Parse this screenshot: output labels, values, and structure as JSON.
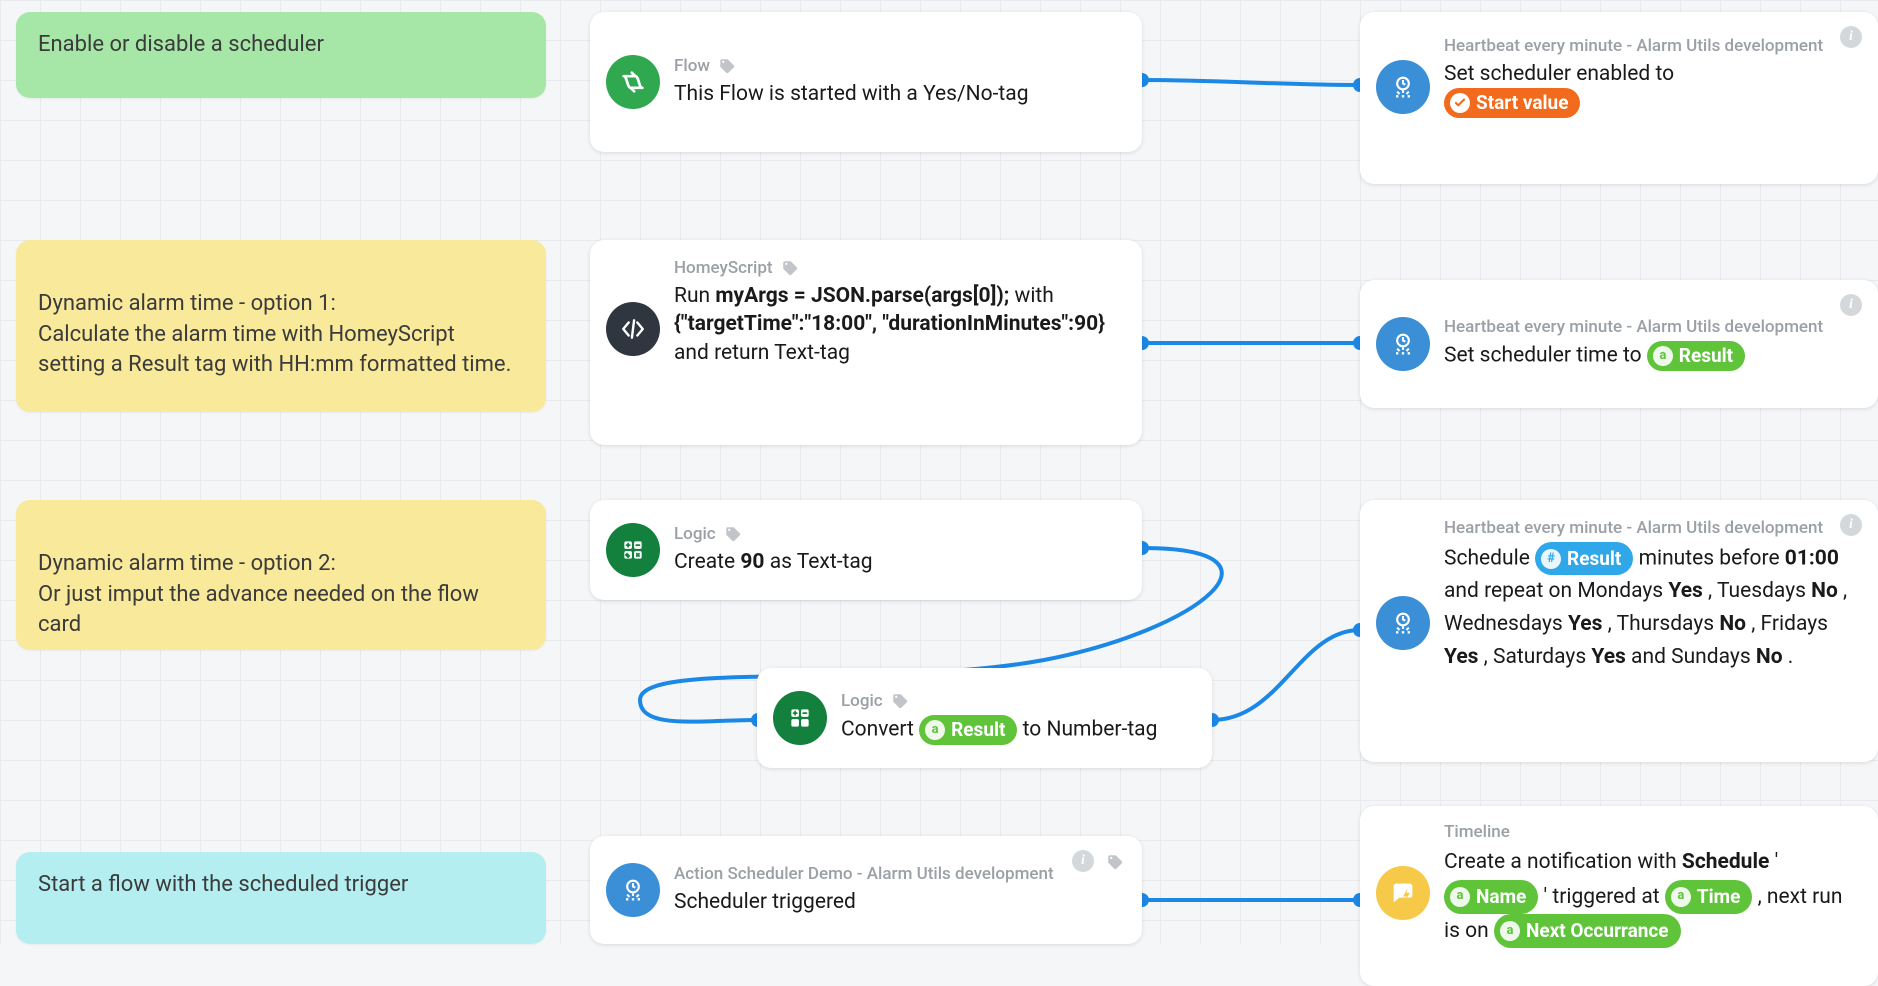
{
  "notes": {
    "n1": "Enable or disable a scheduler",
    "n2": "Dynamic alarm time - option 1:\nCalculate the alarm time with HomeyScript setting a Result tag with HH:mm formatted time.",
    "n3": "Dynamic alarm time - option 2:\nOr just imput the advance needed on the flow card",
    "n4": "Start a flow with the scheduled trigger"
  },
  "cards": {
    "flow1": {
      "meta": "Flow",
      "text": "This Flow is started with a Yes/No-tag"
    },
    "hb1": {
      "meta": "Heartbeat every minute - Alarm Utils development",
      "pre": "Set scheduler enabled to",
      "pill": "Start value"
    },
    "hs1": {
      "meta": "HomeyScript",
      "pre": "Run ",
      "code1": "myArgs = JSON.parse(args[0]);",
      "mid": " with ",
      "code2": "{\"targetTime\":\"18:00\", \"durationInMinutes\":90}",
      "post": " and return Text-tag"
    },
    "hb2": {
      "meta": "Heartbeat every minute - Alarm Utils development",
      "pre": "Set scheduler time to ",
      "pill": "Result"
    },
    "lg1": {
      "meta": "Logic",
      "pre": "Create ",
      "bold": "90",
      "post": " as Text-tag"
    },
    "lg2": {
      "meta": "Logic",
      "pre": "Convert ",
      "pill": "Result",
      "post": " to Number-tag"
    },
    "hb3": {
      "meta": "Heartbeat every minute - Alarm Utils development",
      "t1": "Schedule ",
      "pill": "Result",
      "t2": " minutes before ",
      "b1": "01:00",
      "t3": " and repeat on Mondays ",
      "b2": "Yes",
      "t4": " , Tuesdays ",
      "b3": "No",
      "t5": " , Wednesdays ",
      "b4": "Yes",
      "t6": " , Thursdays ",
      "b5": "No",
      "t7": " , Fridays ",
      "b6": "Yes",
      "t8": " , Saturdays ",
      "b7": "Yes",
      "t9": " and Sundays ",
      "b8": "No",
      "t10": " ."
    },
    "sd1": {
      "meta": "Action Scheduler Demo - Alarm Utils development",
      "text": "Scheduler triggered"
    },
    "tl1": {
      "meta": "Timeline",
      "t1": "Create a notification with ",
      "b1": "Schedule",
      "t2": " '",
      "p1": "Name",
      "t3": "' triggered at ",
      "p2": "Time",
      "t4": ", next run is on ",
      "p3": "Next Occurrance"
    }
  }
}
